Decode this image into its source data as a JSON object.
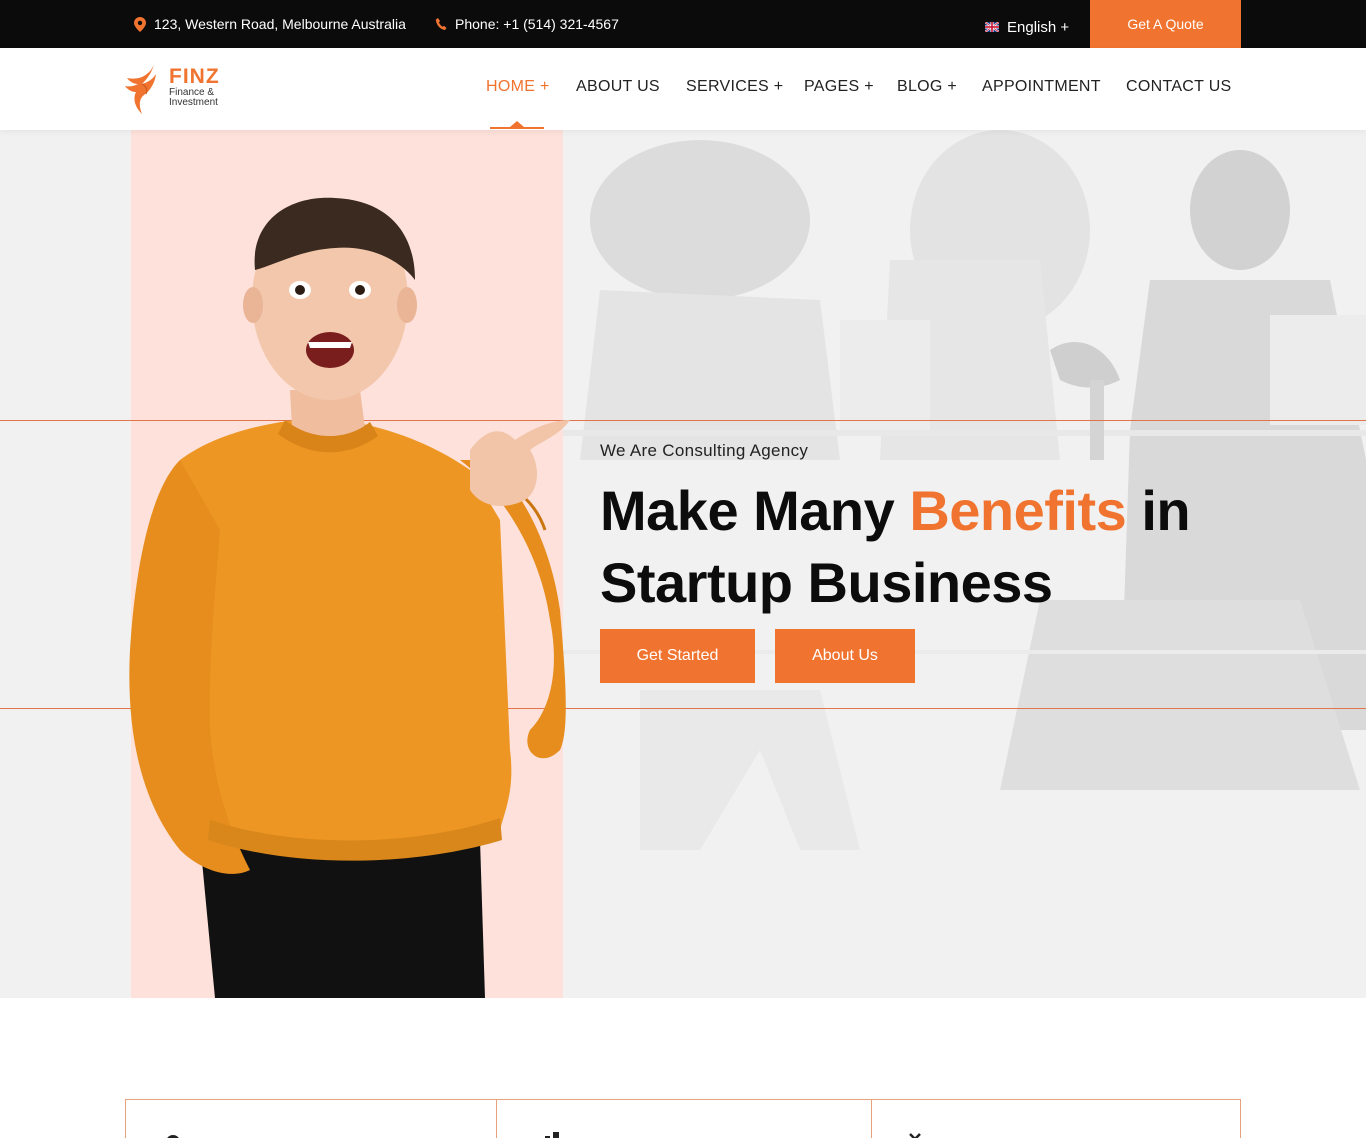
{
  "topbar": {
    "address": "123, Western Road, Melbourne Australia",
    "phone": "Phone: +1 (514) 321-4567",
    "language": "English +",
    "quote_label": "Get A Quote"
  },
  "brand": {
    "name": "FINZ",
    "tagline": "Finance & Investment",
    "accent_color": "#f0742f"
  },
  "nav": {
    "items": [
      {
        "label": "HOME +",
        "active": true
      },
      {
        "label": "ABOUT US"
      },
      {
        "label": "SERVICES +"
      },
      {
        "label": "PAGES +"
      },
      {
        "label": "BLOG +"
      },
      {
        "label": "APPOINTMENT"
      },
      {
        "label": "CONTACT US"
      }
    ]
  },
  "hero": {
    "subtitle": "We Are Consulting Agency",
    "title_part1": "Make Many ",
    "title_accent": "Benefits",
    "title_part2": " in Startup Business",
    "primary_button": "Get Started",
    "secondary_button": "About Us"
  },
  "icons": {
    "address": "map-pin-icon",
    "phone": "phone-icon",
    "language": "uk-flag-icon"
  }
}
